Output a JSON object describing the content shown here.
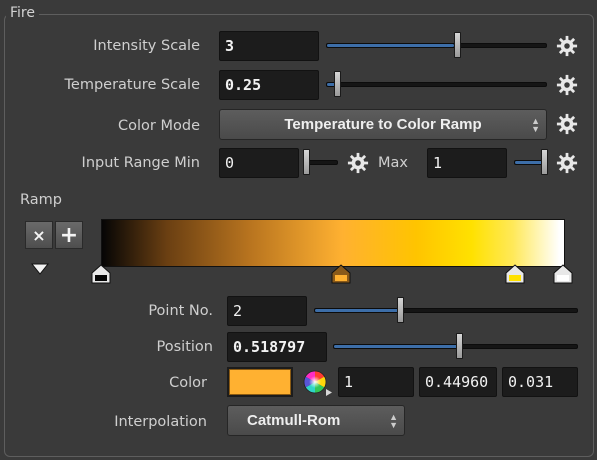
{
  "panel": {
    "title": "Fire"
  },
  "intensity_scale": {
    "label": "Intensity Scale",
    "value": "3",
    "slider_fraction": 0.58
  },
  "temperature_scale": {
    "label": "Temperature Scale",
    "value": "0.25",
    "slider_fraction": 0.05
  },
  "color_mode": {
    "label": "Color Mode",
    "selected": "Temperature to Color Ramp"
  },
  "input_range": {
    "label_min": "Input Range Min",
    "min_value": "0",
    "label_max": "Max",
    "max_value": "1",
    "min_slider_fraction": 0.0,
    "max_slider_fraction": 1.0
  },
  "ramp": {
    "label": "Ramp",
    "delete_symbol": "×",
    "add_symbol": "+",
    "point_no": {
      "label": "Point No.",
      "value": "2",
      "slider_fraction": 0.33
    },
    "position": {
      "label": "Position",
      "value": "0.518797",
      "slider_fraction": 0.52
    },
    "color": {
      "label": "Color",
      "r": "1",
      "g": "0.44960",
      "b": "0.031",
      "swatch_hex": "#ffb131"
    },
    "interpolation": {
      "label": "Interpolation",
      "selected": "Catmull-Rom"
    },
    "markers": [
      {
        "name": "ramp-key-black",
        "color": "#050505",
        "selected": false
      },
      {
        "name": "ramp-key-orange",
        "color": "#ffb131",
        "selected": true
      },
      {
        "name": "ramp-key-yellow",
        "color": "#ffe100",
        "selected": false
      },
      {
        "name": "ramp-key-white",
        "color": "#ffffff",
        "selected": false
      }
    ]
  },
  "colors": {
    "background": "#3a3a3a",
    "field": "#1c1c1c",
    "slider_fill": "#3d6ea8",
    "accent_orange": "#ffb131"
  },
  "icons": {
    "gear": "gear-icon",
    "dropdown_arrows": "updown-arrows-icon",
    "color_wheel": "color-wheel-icon"
  }
}
